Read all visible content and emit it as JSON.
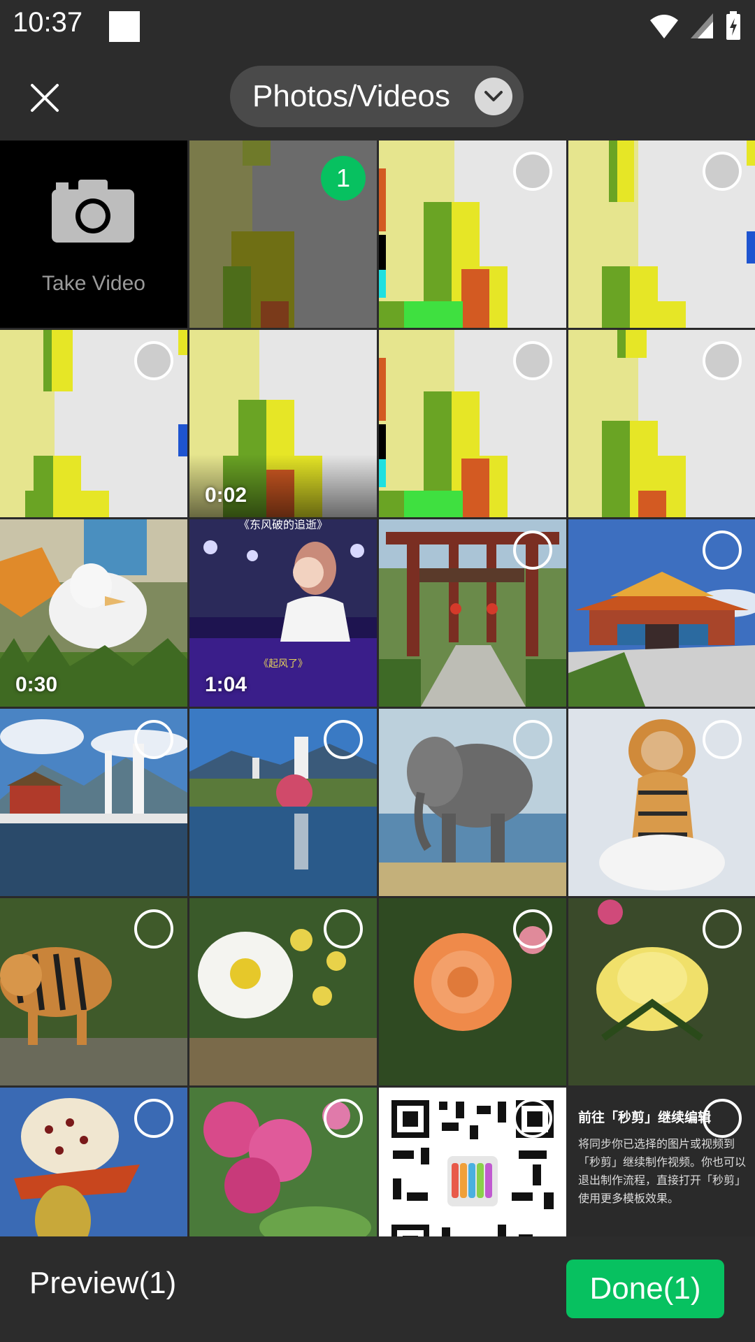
{
  "status_bar": {
    "time": "10:37"
  },
  "header": {
    "album_label": "Photos/Videos"
  },
  "grid": {
    "camera_label": "Take Video",
    "selected_index": "1",
    "durations": {
      "t6": "0:02",
      "t9": "0:30",
      "t10": "1:04"
    },
    "video_caption_top": "《东风破的追逝》",
    "video_caption_bottom": "《起风了》",
    "promo": {
      "title": "前往「秒剪」继续编辑",
      "body": "将同步你已选择的图片或视频到「秒剪」继续制作视频。你也可以退出制作流程，直接打开「秒剪」使用更多模板效果。"
    }
  },
  "footer": {
    "preview_label": "Preview(1)",
    "done_label": "Done(1)"
  },
  "colors": {
    "accent": "#07c160",
    "background": "#2a2a2a"
  }
}
